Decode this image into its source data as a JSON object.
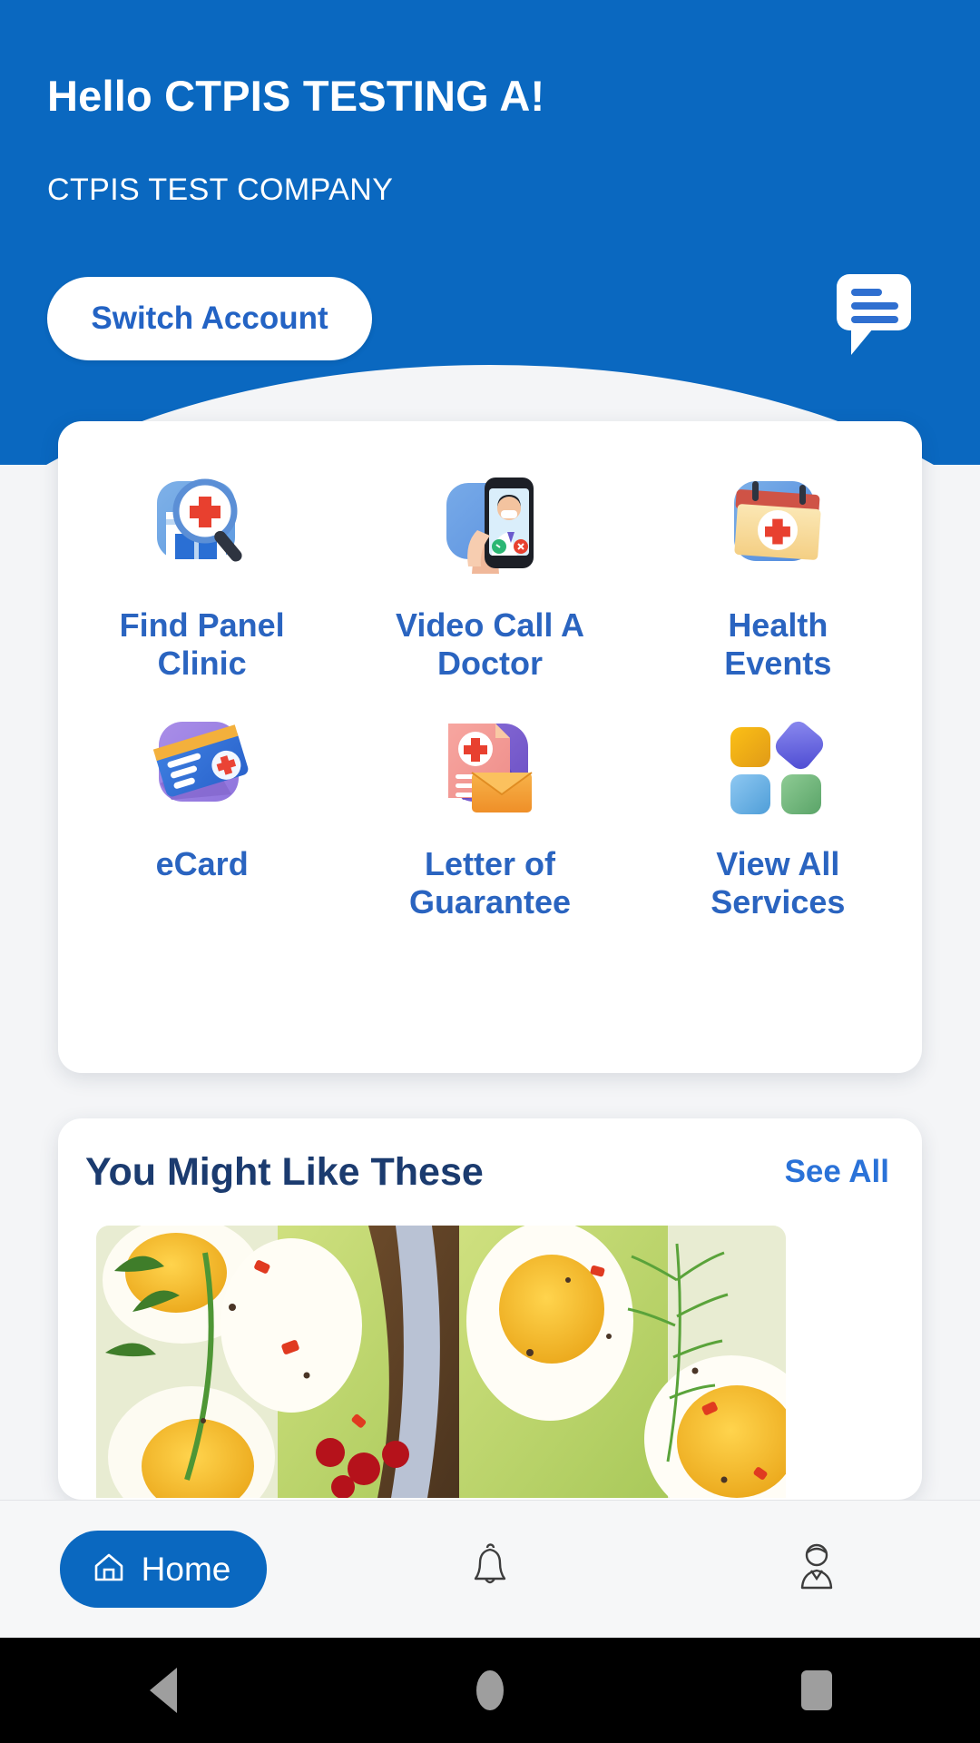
{
  "header": {
    "greeting": "Hello CTPIS TESTING A!",
    "company": "CTPIS TEST COMPANY",
    "switch_account_label": "Switch Account",
    "chat_icon": "chat-bubble-icon",
    "background_color": "#0a68c0"
  },
  "services": [
    {
      "label": "Find Panel Clinic",
      "icon": "clinic-search-icon"
    },
    {
      "label": "Video Call A Doctor",
      "icon": "video-doctor-icon"
    },
    {
      "label": "Health Events",
      "icon": "calendar-health-icon"
    },
    {
      "label": "eCard",
      "icon": "ecard-icon"
    },
    {
      "label": "Letter of Guarantee",
      "icon": "letter-guarantee-icon"
    },
    {
      "label": "View All Services",
      "icon": "grid-apps-icon"
    }
  ],
  "promo": {
    "title": "You Might Like These",
    "see_all_label": "See All",
    "image_alt": "boiled eggs on avocado toast with herbs and pomegranate"
  },
  "bottom_nav": [
    {
      "label": "Home",
      "icon": "home-icon",
      "active": true
    },
    {
      "label": "",
      "icon": "bell-icon",
      "active": false
    },
    {
      "label": "",
      "icon": "profile-icon",
      "active": false
    }
  ],
  "android_nav": [
    {
      "icon": "back-triangle-icon"
    },
    {
      "icon": "home-circle-icon"
    },
    {
      "icon": "recents-square-icon"
    }
  ],
  "colors": {
    "brand_blue": "#0a68c0",
    "label_blue": "#2a64c0",
    "title_navy": "#1b3b6f",
    "link_blue": "#2a72d8",
    "page_bg": "#f4f5f7"
  }
}
